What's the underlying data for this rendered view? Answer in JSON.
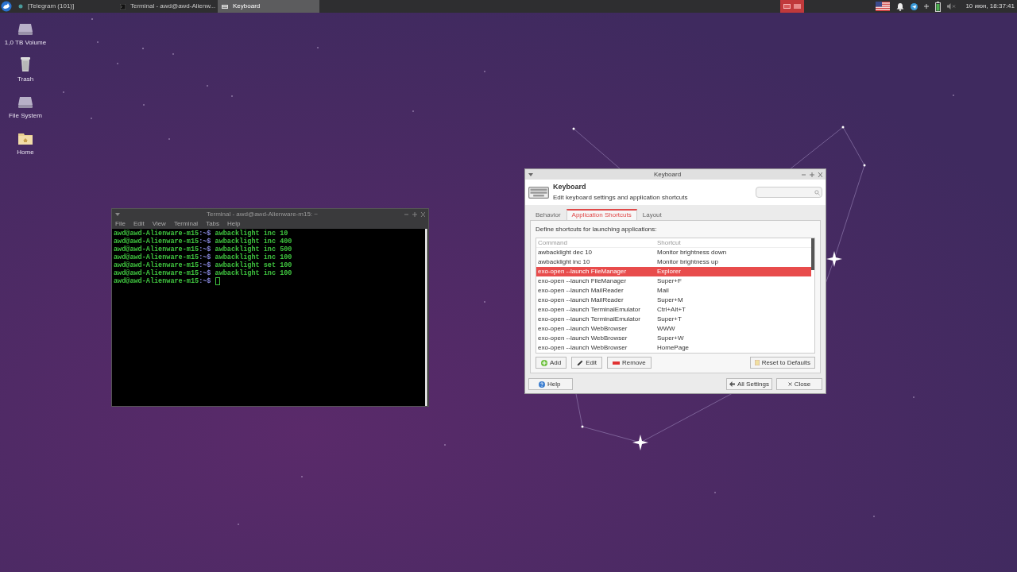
{
  "taskbar": {
    "tasks": [
      {
        "kind": "telegram",
        "label": "[Telegram (101)]",
        "selected": false
      },
      {
        "kind": "terminal",
        "label": "Terminal - awd@awd-Alienw...",
        "selected": false
      },
      {
        "kind": "keyboard",
        "label": "Keyboard",
        "selected": true
      }
    ],
    "workspaces": [
      {
        "selected": true
      },
      {
        "selected": false
      }
    ],
    "clock": "10 июн, 18:37:41"
  },
  "desktop_icons": [
    {
      "kind": "drive",
      "label": "1,0 TB Volume"
    },
    {
      "kind": "trash",
      "label": "Trash"
    },
    {
      "kind": "drive",
      "label": "File System"
    },
    {
      "kind": "folder",
      "label": "Home"
    }
  ],
  "terminal": {
    "title": "Terminal - awd@awd-Alienware-m15: ~",
    "menu": [
      "File",
      "Edit",
      "View",
      "Terminal",
      "Tabs",
      "Help"
    ],
    "lines": [
      {
        "prompt": "awd@awd-Alienware-m15",
        "path": ":~$",
        "command": "awbacklight inc 10"
      },
      {
        "prompt": "awd@awd-Alienware-m15",
        "path": ":~$",
        "command": "awbacklight inc 400"
      },
      {
        "prompt": "awd@awd-Alienware-m15",
        "path": ":~$",
        "command": "awbacklight inc 500"
      },
      {
        "prompt": "awd@awd-Alienware-m15",
        "path": ":~$",
        "command": "awbacklight inc 100"
      },
      {
        "prompt": "awd@awd-Alienware-m15",
        "path": ":~$",
        "command": "awbacklight set 100"
      },
      {
        "prompt": "awd@awd-Alienware-m15",
        "path": ":~$",
        "command": "awbacklight inc 100"
      },
      {
        "prompt": "awd@awd-Alienware-m15",
        "path": ":~$",
        "cursor": true
      }
    ]
  },
  "keyboard": {
    "title": "Keyboard",
    "heading": "Keyboard",
    "subtitle": "Edit keyboard settings and application shortcuts",
    "tabs": [
      {
        "label": "Behavior",
        "selected": false
      },
      {
        "label": "Application Shortcuts",
        "selected": true
      },
      {
        "label": "Layout",
        "selected": false
      }
    ],
    "description": "Define shortcuts for launching applications:",
    "columns": [
      "Command",
      "Shortcut"
    ],
    "rows": [
      {
        "command": "awbacklight dec 10",
        "shortcut": "Monitor brightness down",
        "selected": false
      },
      {
        "command": "awbacklight inc 10",
        "shortcut": "Monitor brightness up",
        "selected": false
      },
      {
        "command": "exo-open --launch FileManager",
        "shortcut": "Explorer",
        "selected": true
      },
      {
        "command": "exo-open --launch FileManager",
        "shortcut": "Super+F",
        "selected": false
      },
      {
        "command": "exo-open --launch MailReader",
        "shortcut": "Mail",
        "selected": false
      },
      {
        "command": "exo-open --launch MailReader",
        "shortcut": "Super+M",
        "selected": false
      },
      {
        "command": "exo-open --launch TerminalEmulator",
        "shortcut": "Ctrl+Alt+T",
        "selected": false
      },
      {
        "command": "exo-open --launch TerminalEmulator",
        "shortcut": "Super+T",
        "selected": false
      },
      {
        "command": "exo-open --launch WebBrowser",
        "shortcut": "WWW",
        "selected": false
      },
      {
        "command": "exo-open --launch WebBrowser",
        "shortcut": "Super+W",
        "selected": false
      },
      {
        "command": "exo-open --launch WebBrowser",
        "shortcut": "HomePage",
        "selected": false
      }
    ],
    "list_buttons": [
      {
        "kind": "add",
        "label": "Add"
      },
      {
        "kind": "edit",
        "label": "Edit"
      },
      {
        "kind": "remove",
        "label": "Remove"
      }
    ],
    "reset_button": "Reset to Defaults",
    "help_button": "Help",
    "all_settings_button": "All Settings",
    "close_button": "Close"
  }
}
